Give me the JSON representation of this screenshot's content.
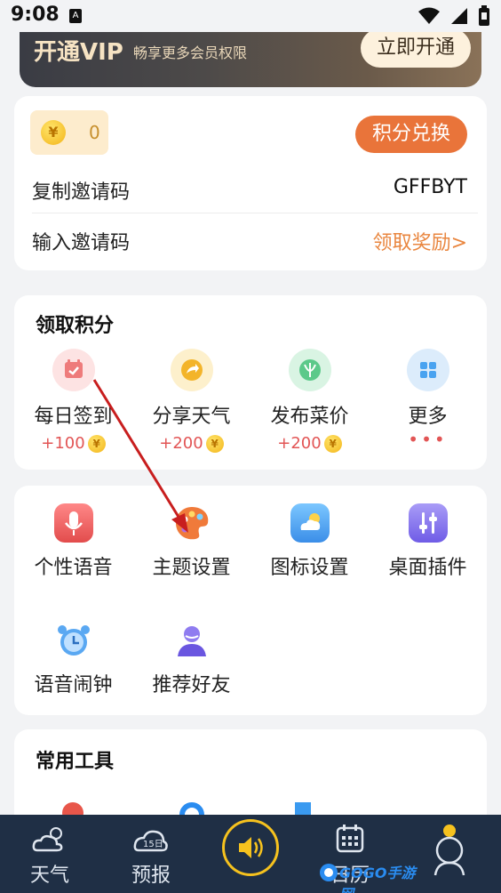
{
  "status_bar": {
    "time": "9:08",
    "app_glyph": "A"
  },
  "vip": {
    "title": "开通VIP",
    "subtitle": "畅享更多会员权限",
    "button": "立即开通"
  },
  "invite": {
    "coins": "0",
    "exchange_button": "积分兑换",
    "copy_label": "复制邀请码",
    "copy_code": "GFFBYT",
    "enter_label": "输入邀请码",
    "enter_action": "领取奖励>"
  },
  "points": {
    "title": "领取积分",
    "items": [
      {
        "label": "每日签到",
        "reward": "+100",
        "icon": "calendar-check-icon",
        "color": "#f4a3a3"
      },
      {
        "label": "分享天气",
        "reward": "+200",
        "icon": "share-arrow-icon",
        "color": "#f3b42a"
      },
      {
        "label": "发布菜价",
        "reward": "+200",
        "icon": "vegetable-icon",
        "color": "#5cc98a"
      },
      {
        "label": "更多",
        "reward": "•••",
        "icon": "grid-more-icon",
        "color": "#4aa3f0"
      }
    ]
  },
  "features": {
    "items": [
      {
        "label": "个性语音",
        "icon": "microphone-icon"
      },
      {
        "label": "主题设置",
        "icon": "palette-icon"
      },
      {
        "label": "图标设置",
        "icon": "weather-icon-setting-icon"
      },
      {
        "label": "桌面插件",
        "icon": "sliders-icon"
      },
      {
        "label": "语音闹钟",
        "icon": "alarm-clock-icon"
      },
      {
        "label": "推荐好友",
        "icon": "friend-icon"
      }
    ]
  },
  "tools": {
    "title": "常用工具"
  },
  "nav": {
    "items": [
      {
        "label": "天气",
        "icon": "cloud-sun-icon"
      },
      {
        "label": "预报",
        "icon": "forecast-15-icon",
        "badge": "15日"
      },
      {
        "label": "",
        "icon": "speaker-icon"
      },
      {
        "label": "日历",
        "icon": "calendar-icon"
      },
      {
        "label": "",
        "icon": "profile-icon"
      }
    ]
  },
  "watermark": {
    "text": "GOGO手游网"
  },
  "colors": {
    "accent": "#e9743a",
    "link": "#e9863f",
    "nav_bg": "#1f2f45",
    "vip_text": "#f6e3c3",
    "annotation_arrow": "#c81e1e"
  }
}
